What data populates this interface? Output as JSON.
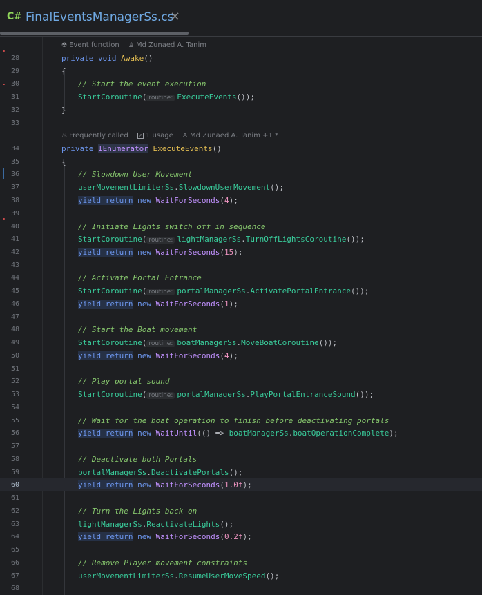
{
  "tab": {
    "lang": "C#",
    "title": "FinalEventsManagerSs.cs",
    "close": "×"
  },
  "lens1": {
    "event": "Event function",
    "author": "Md Zunaed A. Tanim"
  },
  "lens2": {
    "frequency": "Frequently called",
    "usage": "1 usage",
    "author": "Md Zunaed A. Tanim +1 *"
  },
  "hint": "routine:",
  "lines": {
    "n28": "28",
    "n29": "29",
    "n30": "30",
    "n31": "31",
    "n32": "32",
    "n33": "33",
    "n34": "34",
    "n35": "35",
    "n36": "36",
    "n37": "37",
    "n38": "38",
    "n39": "39",
    "n40": "40",
    "n41": "41",
    "n42": "42",
    "n43": "43",
    "n44": "44",
    "n45": "45",
    "n46": "46",
    "n47": "47",
    "n48": "48",
    "n49": "49",
    "n50": "50",
    "n51": "51",
    "n52": "52",
    "n53": "53",
    "n54": "54",
    "n55": "55",
    "n56": "56",
    "n57": "57",
    "n58": "58",
    "n59": "59",
    "n60": "60",
    "n61": "61",
    "n62": "62",
    "n63": "63",
    "n64": "64",
    "n65": "65",
    "n66": "66",
    "n67": "67",
    "n68": "68"
  },
  "tokens": {
    "private": "private",
    "void": "void",
    "awake": "Awake",
    "parens": "()",
    "ob": "{",
    "cb": "}",
    "c30": "// Start the event execution",
    "startCo": "StartCoroutine",
    "lp": "(",
    "rpsemi": ");",
    "call": "()",
    "executeEvents": "ExecuteEvents",
    "ienum": "IEnumerator",
    "c36": "// Slowdown User Movement",
    "uml": "userMovementLimiterSs",
    "dot": ".",
    "slowdown": "SlowdownUserMovement",
    "callsemi": "();",
    "yield": "yield",
    "return": "return",
    "new": "new",
    "wfs": "WaitForSeconds",
    "v4": "4",
    "v15": "15",
    "v1": "1",
    "v10f": "1.0f",
    "v02f": "0.2f",
    "c40": "// Initiate Lights switch off in sequence",
    "lms": "lightManagerSs",
    "turnOff": "TurnOffLightsCoroutine",
    "rrsemi": "());",
    "c44": "// Activate Portal Entrance",
    "pms": "portalManagerSs",
    "activate": "ActivatePortalEntrance",
    "c48": "// Start the Boat movement",
    "bms": "boatManagerSs",
    "moveBoat": "MoveBoatCoroutine",
    "c52": "// Play portal sound",
    "playSound": "PlayPortalEntranceSound",
    "c55": "// Wait for the boat operation to finish before deactivating portals",
    "waitUntil": "WaitUntil",
    "lambda": "(() => ",
    "boatComplete": "boatOperationComplete",
    "c58": "// Deactivate both Portals",
    "deactivate": "DeactivatePortals",
    "c62": "// Turn the Lights back on",
    "reactivate": "ReactivateLights",
    "c66": "// Remove Player movement constraints",
    "resume": "ResumeUserMoveSpeed"
  },
  "colors": {
    "keyword": "#6c95eb",
    "method": "#39cc9b",
    "type": "#c191ff",
    "comment": "#85c46c",
    "number": "#ed94c0"
  }
}
